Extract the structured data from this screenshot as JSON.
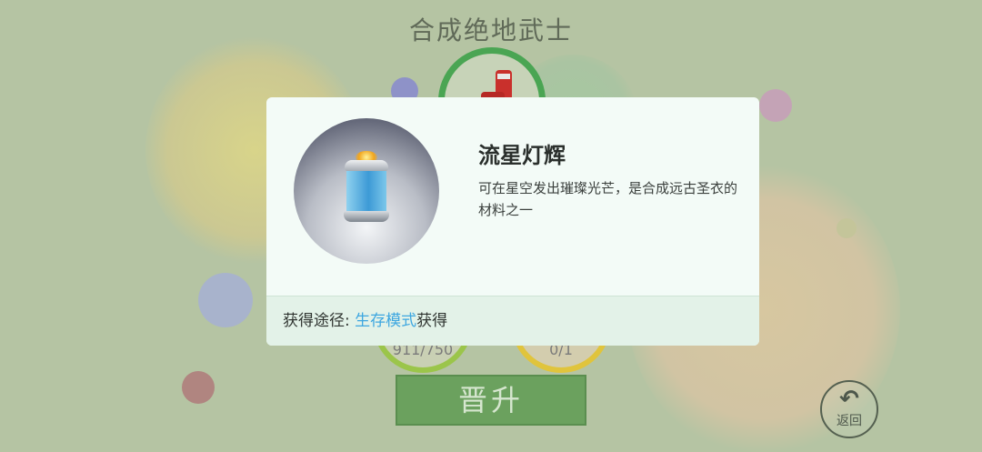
{
  "screen": {
    "title": "合成绝地武士",
    "upgrade_label": "晋升",
    "back_label": "返回",
    "stat_left": "911/750",
    "stat_right": "0/1"
  },
  "popup": {
    "item_name": "流星灯辉",
    "item_description": "可在星空发出璀璨光芒，是合成远古圣衣的材料之一",
    "source_label": "获得途径:",
    "source_mode": "生存模式",
    "source_suffix": "获得"
  },
  "icons": {
    "back": "undo-arrow-icon",
    "item": "lantern-jar-icon"
  },
  "colors": {
    "accent_green": "#4aa553",
    "link_blue": "#3ea7e0",
    "upgrade_button": "#6ba15e"
  }
}
